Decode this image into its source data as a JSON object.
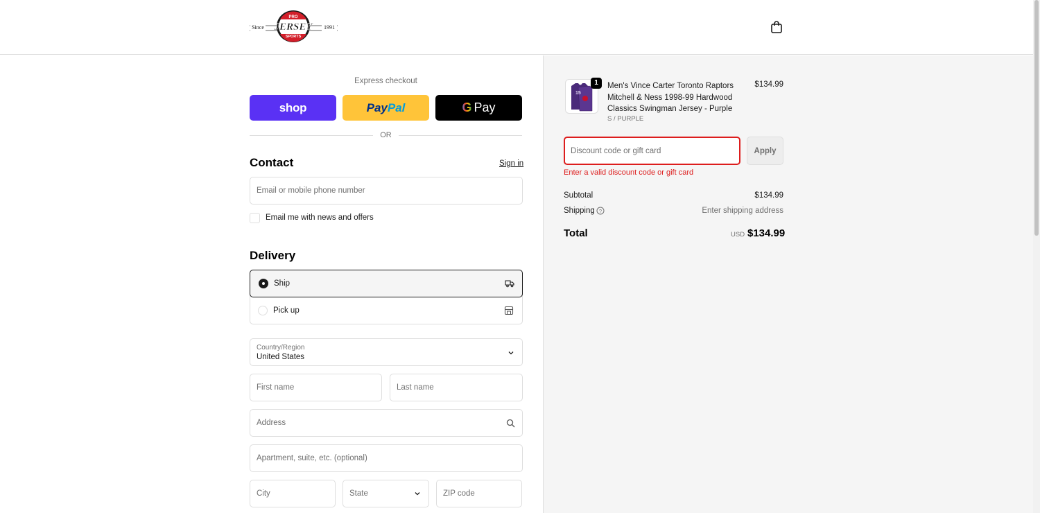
{
  "header": {
    "logo": {
      "top_text": "PRO",
      "main_text": "JERSEY",
      "bottom_text": "SPORTS",
      "left_text": "Since",
      "right_text": "1991"
    }
  },
  "express": {
    "label": "Express checkout",
    "shop_label": "shop",
    "paypal_label_1": "Pay",
    "paypal_label_2": "Pal",
    "gpay_g": "G",
    "gpay_label": "Pay",
    "or_label": "OR"
  },
  "contact": {
    "title": "Contact",
    "sign_in": "Sign in",
    "email_placeholder": "Email or mobile phone number",
    "news_label": "Email me with news and offers"
  },
  "delivery": {
    "title": "Delivery",
    "options": [
      {
        "label": "Ship",
        "selected": true
      },
      {
        "label": "Pick up",
        "selected": false
      }
    ],
    "country_label": "Country/Region",
    "country_value": "United States",
    "first_name": "First name",
    "last_name": "Last name",
    "address": "Address",
    "apartment": "Apartment, suite, etc. (optional)",
    "city": "City",
    "state": "State",
    "zip": "ZIP code"
  },
  "summary": {
    "product": {
      "name": "Men's Vince Carter Toronto Raptors Mitchell & Ness 1998-99 Hardwood Classics Swingman Jersey - Purple",
      "variant": "S / PURPLE",
      "price": "$134.99",
      "quantity": "1",
      "jersey_number": "15"
    },
    "discount_placeholder": "Discount code or gift card",
    "apply_label": "Apply",
    "error": "Enter a valid discount code or gift card",
    "subtotal_label": "Subtotal",
    "subtotal_value": "$134.99",
    "shipping_label": "Shipping",
    "shipping_value": "Enter shipping address",
    "total_label": "Total",
    "currency": "USD",
    "total_value": "$134.99"
  },
  "colors": {
    "shop": "#5a31f4",
    "paypal": "#ffc439",
    "error": "#dd1d1d",
    "summary_bg": "#f5f5f5"
  }
}
